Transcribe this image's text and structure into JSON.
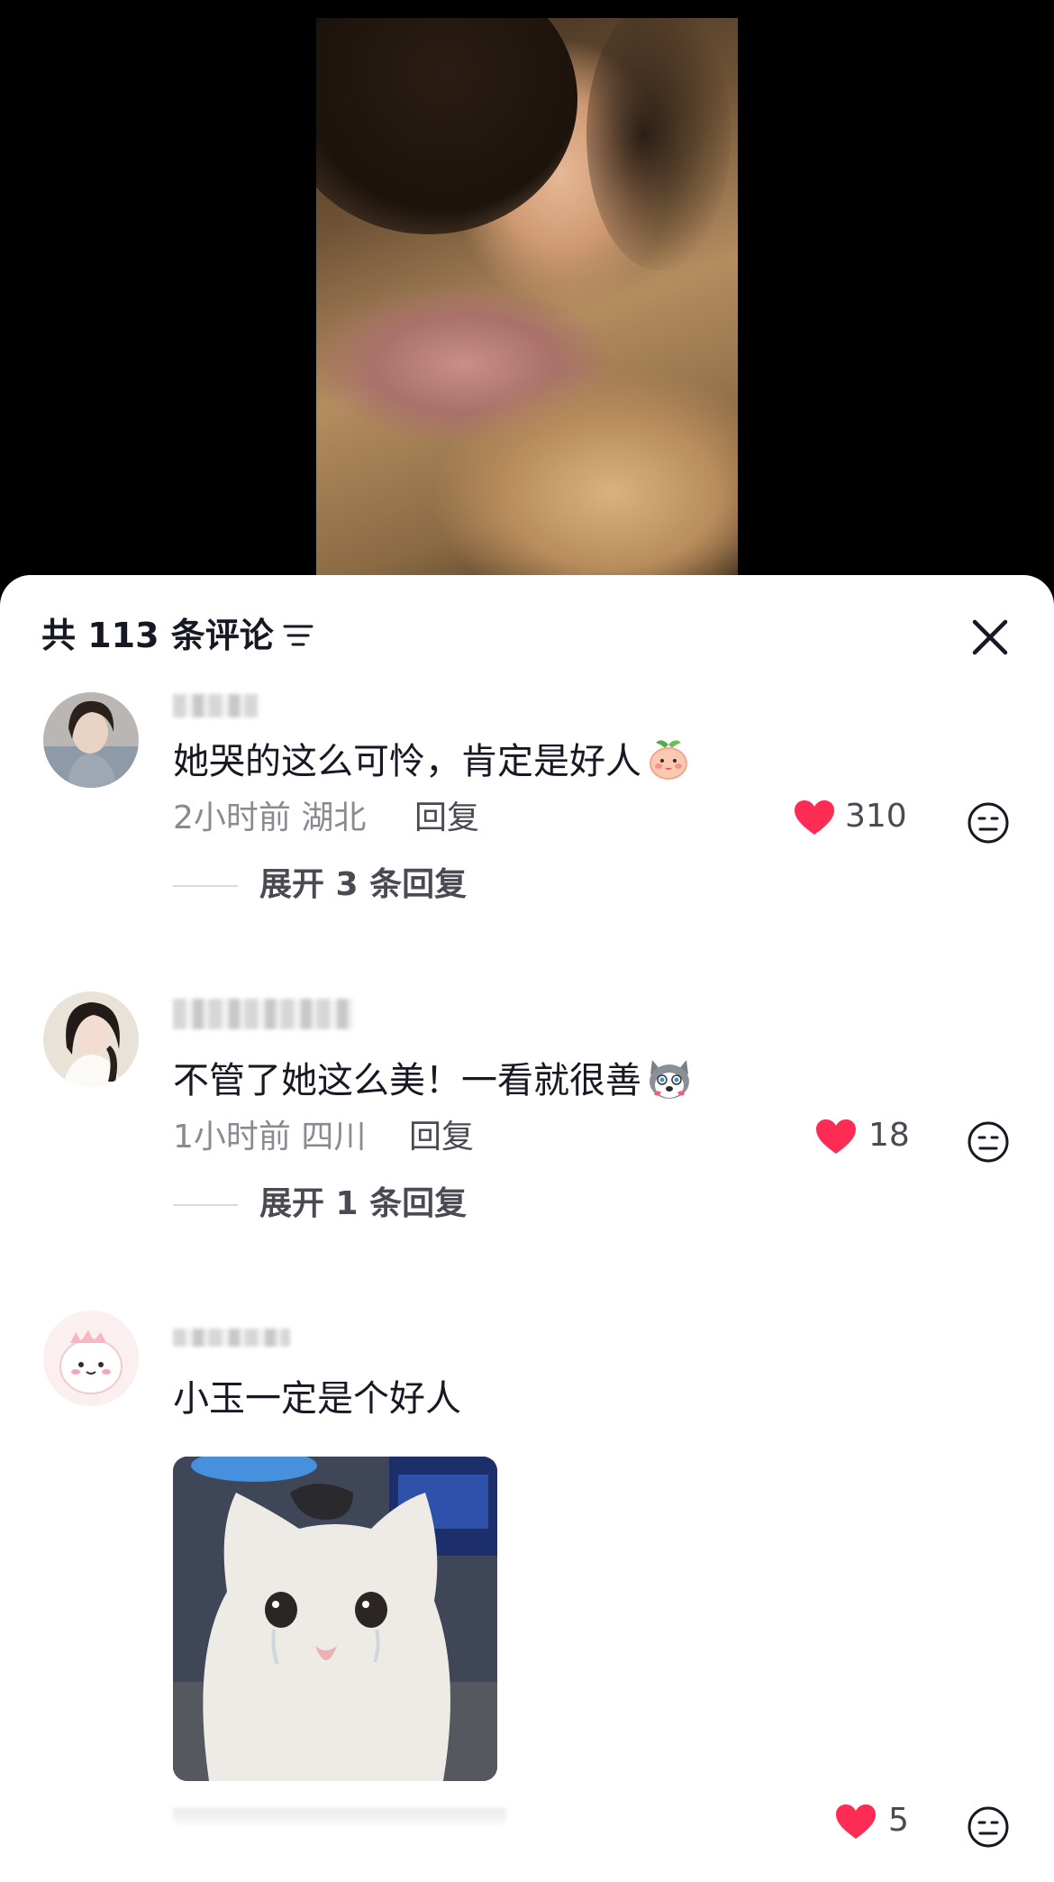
{
  "header": {
    "comment_count": "共 113 条评论",
    "filter_icon": "filter-icon",
    "close_icon": "close-icon"
  },
  "comments": [
    {
      "text": "她哭的这么可怜，肯定是好人",
      "emoji": "peach-face-emoji",
      "time_location": "2小时前 湖北",
      "reply_label": "回复",
      "likes": "310",
      "expand_label": "展开 3 条回复"
    },
    {
      "text": "不管了她这么美！一看就很善",
      "emoji": "husky-face-emoji",
      "time_location": "1小时前 四川",
      "reply_label": "回复",
      "likes": "18",
      "expand_label": "展开 1 条回复"
    },
    {
      "text": "小玉一定是个好人",
      "image": "crying-cat-sticker",
      "likes": "5"
    }
  ],
  "colors": {
    "heart": "#fe2c55",
    "text_primary": "#161823",
    "text_secondary": "#8a8b91"
  }
}
